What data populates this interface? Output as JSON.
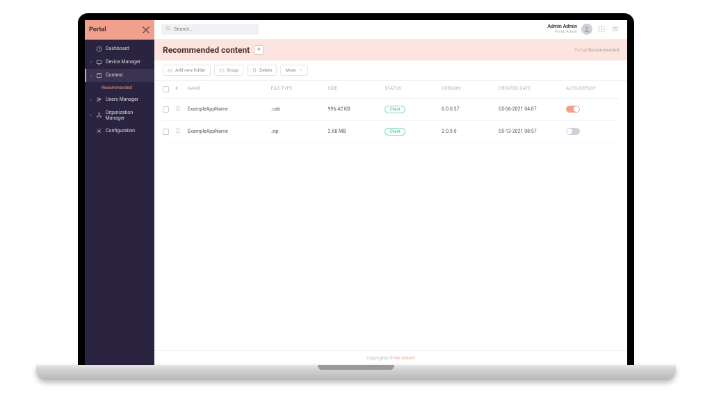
{
  "brand": {
    "name": "Portal"
  },
  "topbar": {
    "search_placeholder": "Search...",
    "user_name": "Admin Admin",
    "user_role": "Portal Admin"
  },
  "sidebar": {
    "items": [
      {
        "label": "Dashboard"
      },
      {
        "label": "Device Manager"
      },
      {
        "label": "Content",
        "active": true,
        "sub": [
          {
            "label": "Recommended"
          }
        ]
      },
      {
        "label": "Users Manager"
      },
      {
        "label": "Organization Manager"
      },
      {
        "label": "Configuration"
      }
    ]
  },
  "page": {
    "title": "Recommended content",
    "breadcrumb": {
      "root": "Portal",
      "current": "Recommended"
    }
  },
  "toolbar": {
    "add_folder": "Add new folder",
    "group": "Group",
    "delete": "Delete",
    "more": "More"
  },
  "table": {
    "headers": {
      "hash": "#",
      "name": "NAME",
      "file_type": "FILE TYPE",
      "size": "SIZE",
      "status": "STATUS",
      "version": "VERSION",
      "created": "CREATED DATE",
      "auto": "AUTO-DEPLOY"
    },
    "rows": [
      {
        "name": "ExampleAppName",
        "file_type": ".cab",
        "size": "996.42 KB",
        "status": "Client",
        "version": "0.0.0.37",
        "created": "05-06-2021 04:07",
        "auto": true
      },
      {
        "name": "ExampleAppName",
        "file_type": ".zip",
        "size": "2.68 MB",
        "status": "Client",
        "version": "2.0.9.0",
        "created": "05-12-2021 08:57",
        "auto": false
      }
    ]
  },
  "footer": {
    "prefix": "Copyrights © ",
    "brand": "We Unterd"
  }
}
